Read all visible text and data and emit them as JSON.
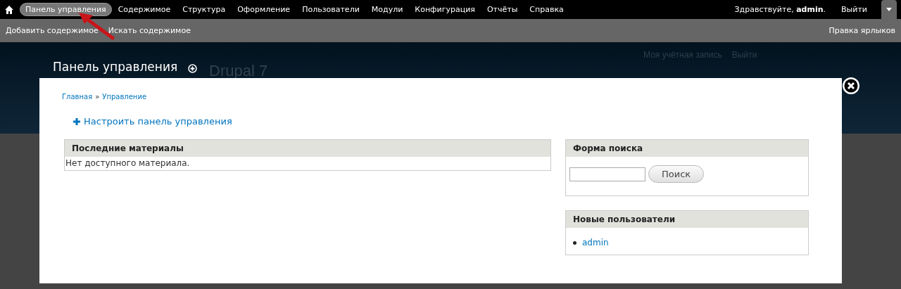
{
  "toolbar": {
    "menu": [
      {
        "label": "Панель управления",
        "selected": true
      },
      {
        "label": "Содержимое",
        "selected": false
      },
      {
        "label": "Структура",
        "selected": false
      },
      {
        "label": "Оформление",
        "selected": false
      },
      {
        "label": "Пользователи",
        "selected": false
      },
      {
        "label": "Модули",
        "selected": false
      },
      {
        "label": "Конфигурация",
        "selected": false
      },
      {
        "label": "Отчёты",
        "selected": false
      },
      {
        "label": "Справка",
        "selected": false
      }
    ],
    "greeting": "Здравствуйте, **admin**.",
    "logout": "Выйти",
    "drawer_expanded": true
  },
  "shortcuts": {
    "items": [
      "Добавить содержимое",
      "Искать содержимое"
    ],
    "edit_link": "Правка ярлыков"
  },
  "header": {
    "title": "Панель управления",
    "site_name": "Drupal 7",
    "secondary_links": [
      "Моя учётная запись",
      "Выйти"
    ]
  },
  "overlay": {
    "breadcrumb": [
      "Главная",
      "Управление"
    ],
    "breadcrumb_separator": "»",
    "customize_link": "Настроить панель управления",
    "main_blocks": [
      {
        "kind": "text",
        "title": "Последние материалы",
        "text": "Нет доступного материала."
      }
    ],
    "side_blocks": [
      {
        "kind": "search",
        "title": "Форма поиска",
        "button": "Поиск"
      },
      {
        "kind": "list",
        "title": "Новые пользователи",
        "items": [
          "admin"
        ]
      }
    ]
  }
}
